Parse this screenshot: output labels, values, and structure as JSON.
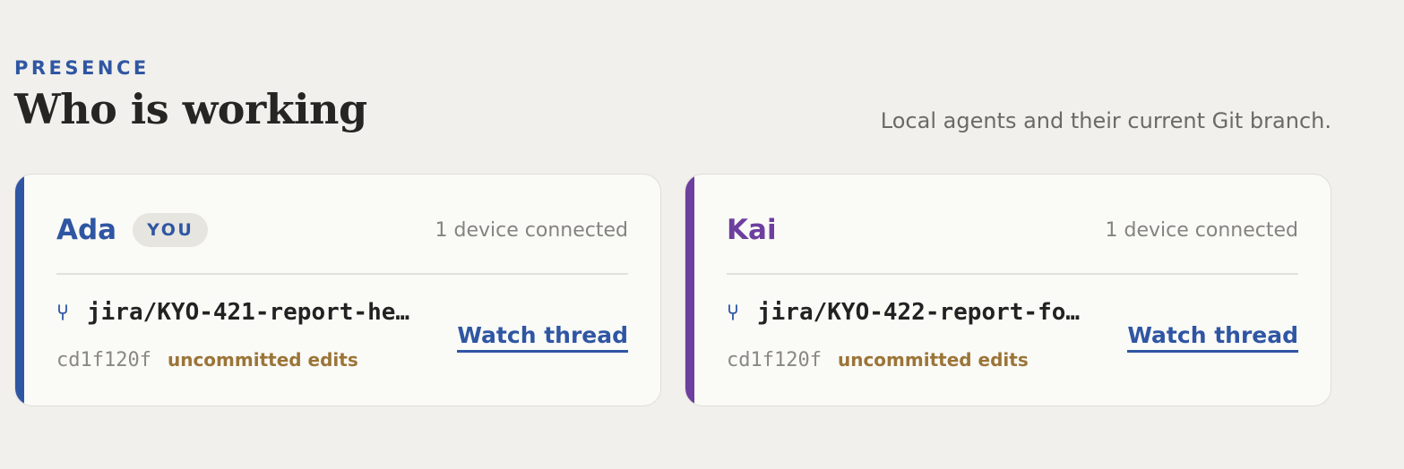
{
  "section": {
    "eyebrow": "PRESENCE",
    "title": "Who is working",
    "subtitle": "Local agents and their current Git branch."
  },
  "colors": {
    "background": "#f1f0ec",
    "card_background": "#fafaf7",
    "brand_blue": "#2f56a3",
    "agent_purple": "#6d3f9e",
    "uncommitted": "#9b7538"
  },
  "agents": [
    {
      "name": "Ada",
      "you_badge": "YOU",
      "devices": "1 device connected",
      "branch_icon": "git-branch-icon",
      "branch": "jira/KYO-421-report-he…",
      "commit": "cd1f120f",
      "status": "uncommitted edits",
      "action": "Watch thread",
      "accent_color": "#2f56a3"
    },
    {
      "name": "Kai",
      "devices": "1 device connected",
      "branch_icon": "git-branch-icon",
      "branch": "jira/KYO-422-report-fo…",
      "commit": "cd1f120f",
      "status": "uncommitted edits",
      "action": "Watch thread",
      "accent_color": "#6d3f9e"
    }
  ]
}
